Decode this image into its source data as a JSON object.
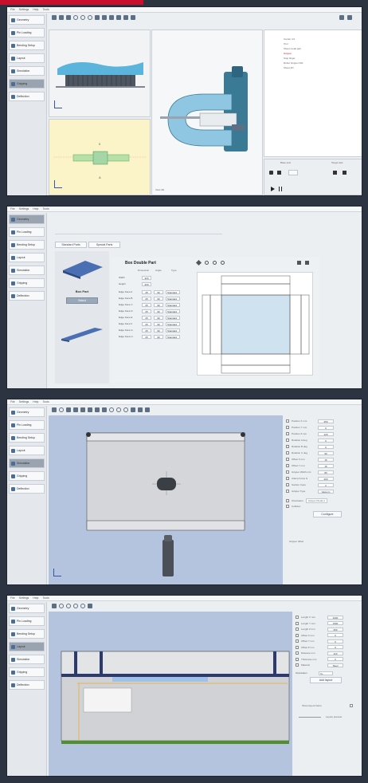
{
  "menu": [
    "File",
    "Settings",
    "Help",
    "Tools"
  ],
  "sidebar": [
    {
      "label": "Geometry",
      "icon": "part-icon"
    },
    {
      "label": "Pin Loading",
      "icon": "pin-icon"
    },
    {
      "label": "Bending Setup",
      "icon": "bend-icon"
    },
    {
      "label": "Layout",
      "icon": "layout-icon"
    },
    {
      "label": "Simulation",
      "icon": "simulation-icon"
    },
    {
      "label": "Gripping",
      "icon": "gripper-icon"
    },
    {
      "label": "Deflection",
      "icon": "deflection-icon"
    }
  ],
  "panel1": {
    "active_sidebar": 5,
    "tree": [
      "Carrier 4.0",
      "Tool",
      "Sheet metal part",
      "Gripper",
      "Stop finger",
      "Robot Gripper 001",
      "Sheet 2D"
    ],
    "controls": {
      "left": "Base axis",
      "right": "Target axis"
    }
  },
  "panel2": {
    "active_sidebar": 0,
    "tabs": [
      "Standard Parts",
      "Special Parts"
    ],
    "part_type": "Box Part",
    "part_button": "Select",
    "title": "Box Double Part",
    "col_headers": [
      "Dimension",
      "Angle",
      "Type"
    ],
    "width_label": "Width",
    "width_value": "320",
    "height_label": "Height",
    "height_value": "200",
    "edges": [
      {
        "label": "Edge Face A",
        "dim": "25",
        "angle": "90",
        "type": "Standard"
      },
      {
        "label": "Edge Face B",
        "dim": "25",
        "angle": "90",
        "type": "Standard"
      },
      {
        "label": "Edge Face C",
        "dim": "25",
        "angle": "90",
        "type": "Standard"
      },
      {
        "label": "Edge Face D",
        "dim": "25",
        "angle": "90",
        "type": "Standard"
      },
      {
        "label": "Edge Face E",
        "dim": "25",
        "angle": "90",
        "type": "Standard"
      },
      {
        "label": "Edge Face F",
        "dim": "25",
        "angle": "90",
        "type": "Standard"
      },
      {
        "label": "Edge Face G",
        "dim": "25",
        "angle": "90",
        "type": "Standard"
      },
      {
        "label": "Edge Face H",
        "dim": "25",
        "angle": "90",
        "type": "Standard"
      }
    ]
  },
  "panel3": {
    "active_sidebar": 4,
    "params": [
      {
        "label": "Position X",
        "unit": "mm",
        "value": "250"
      },
      {
        "label": "Position Y",
        "unit": "mm",
        "value": "0"
      },
      {
        "label": "Position Z",
        "unit": "mm",
        "value": "120"
      },
      {
        "label": "Rotation A",
        "unit": "deg",
        "value": "0"
      },
      {
        "label": "Rotation B",
        "unit": "deg",
        "value": "0"
      },
      {
        "label": "Rotation C",
        "unit": "deg",
        "value": "90"
      },
      {
        "label": "Offset X",
        "unit": "mm",
        "value": "15"
      },
      {
        "label": "Offset Y",
        "unit": "mm",
        "value": "15"
      },
      {
        "label": "Gripper Width",
        "unit": "mm",
        "value": "80"
      },
      {
        "label": "Clamp Force",
        "unit": "N",
        "value": "200"
      },
      {
        "label": "Suction Cups",
        "unit": "",
        "value": "2"
      },
      {
        "label": "Gripper Type",
        "unit": "",
        "value": "Vacuum"
      }
    ],
    "gripper_model": "Gripper Model 1",
    "configure": "Configure",
    "extra": [
      "Orientation",
      "Collision"
    ],
    "bottom_label": "Gripper offset"
  },
  "panel4": {
    "active_sidebar": 3,
    "params": [
      {
        "label": "Length X",
        "unit": "mm",
        "value": "3200"
      },
      {
        "label": "Length Y",
        "unit": "mm",
        "value": "1500"
      },
      {
        "label": "Length Z",
        "unit": "mm",
        "value": "250"
      },
      {
        "label": "Offset X",
        "unit": "mm",
        "value": "0"
      },
      {
        "label": "Offset Y",
        "unit": "mm",
        "value": "0"
      },
      {
        "label": "Offset Z",
        "unit": "mm",
        "value": "0"
      },
      {
        "label": "Distance",
        "unit": "mm",
        "value": "120"
      },
      {
        "label": "Thickness",
        "unit": "mm",
        "value": "2"
      },
      {
        "label": "Material",
        "unit": "",
        "value": "Steel"
      }
    ],
    "orientation_label": "Orientation",
    "orientation_value": "X+",
    "add_button": "Add layout",
    "check_label": "Show layout frame",
    "footer": "Layout preview"
  },
  "colors": {
    "accent": "#c8102e",
    "background": "#2b3440",
    "viewport_blue": "#b4c4de",
    "part_light_blue": "#cfe2ef",
    "yellow_view": "#faf4c8",
    "machine_teal": "#3a7a95"
  }
}
